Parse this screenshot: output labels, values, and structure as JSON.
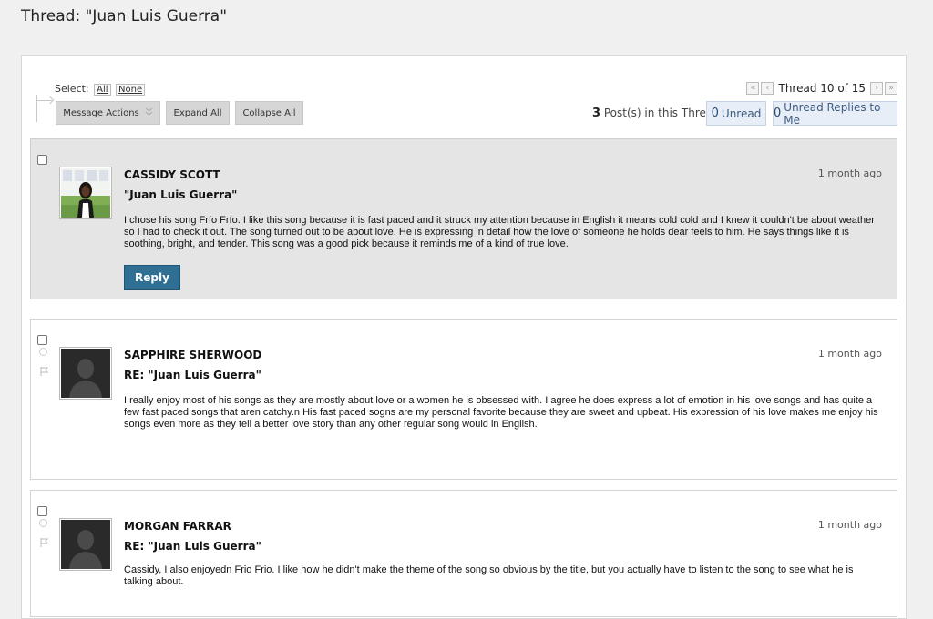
{
  "page": {
    "title": "Thread: \"Juan Luis Guerra\""
  },
  "toolbar": {
    "select_label": "Select:",
    "select_all": "All",
    "select_none": "None",
    "message_actions": "Message Actions",
    "expand_all": "Expand All",
    "collapse_all": "Collapse All"
  },
  "pager": {
    "first_icon": "double-chevron-left-icon",
    "prev_icon": "chevron-left-icon",
    "next_icon": "chevron-right-icon",
    "last_icon": "double-chevron-right-icon",
    "text": "Thread 10 of 15"
  },
  "stats": {
    "post_count": "3",
    "post_count_label": "Post(s) in this Thread",
    "unread_count": "0",
    "unread_label": "Unread",
    "replies_count": "0",
    "replies_label": "Unread Replies to Me"
  },
  "posts": [
    {
      "author": "CASSIDY SCOTT",
      "subject": "\"Juan Luis Guerra\"",
      "time": "1 month ago",
      "body": "I chose his song Frío Frío. I like this song because it is fast paced and it struck my attention because in English it means cold cold and I knew it couldn't be about weather so I had to check it out. The song turned out to be about love. He is expressing in detail how the love of someone he holds dear feels to him. He says things like it is soothing, bright, and tender. This song was a good pick because it reminds me of a kind of true love.",
      "reply_label": "Reply"
    },
    {
      "author": "SAPPHIRE SHERWOOD",
      "subject": "RE: \"Juan Luis Guerra\"",
      "time": "1 month ago",
      "body": "I really enjoy most of his songs as they are mostly about love or a women he is obsessed with. I agree he does express a lot of emotion in his love songs and has quite a few fast paced songs that aren catchy.n His fast paced sogns are my personal favorite because they are sweet and upbeat. His expression of his love makes me enjoy his songs even more as they tell a better love story than any other regular song would in English."
    },
    {
      "author": "MORGAN FARRAR",
      "subject": "RE: \"Juan Luis Guerra\"",
      "time": "1 month ago",
      "body": "Cassidy, I also enjoyedn Frio Frio. I like how he didn't make the theme of the song so obvious by the title, but you actually have to listen to the song to see what he is talking about."
    }
  ]
}
